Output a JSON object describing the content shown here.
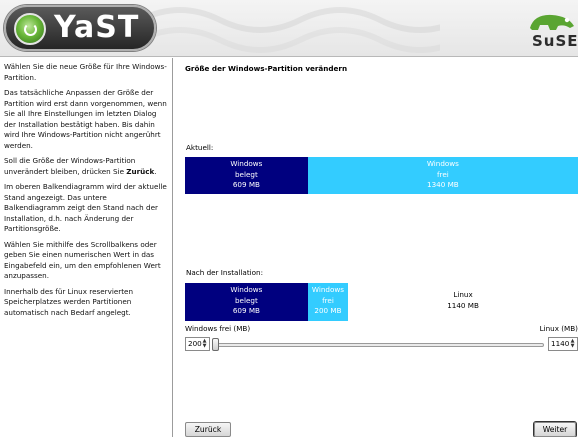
{
  "banner": {
    "app_logo_text": "YaST",
    "vendor_logo_text": "SuSE"
  },
  "help": {
    "paragraphs": [
      "Wählen Sie die neue Größe für Ihre Windows-Partition.",
      "Das tatsächliche Anpassen der Größe der Partition wird erst dann vorgenommen, wenn Sie all Ihre Einstellungen im letzten Dialog der Installation bestätigt haben. Bis dahin wird Ihre Windows-Partition nicht angerührt werden.",
      "Im oberen Balkendiagramm wird der aktuelle Stand angezeigt. Das untere Balkendiagramm zeigt den Stand nach der Installation, d.h. nach Änderung der Partitionsgröße.",
      "Wählen Sie mithilfe des Scrollbalkens oder geben Sie einen numerischen Wert in das Eingabefeld ein, um den empfohlenen Wert anzupassen.",
      "Innerhalb des für Linux reservierten Speicherplatzes werden Partitionen automatisch nach Bedarf angelegt."
    ],
    "unchanged_before": "Soll die Größe der Windows-Partition unverändert bleiben, drücken Sie ",
    "unchanged_bold": "Zurück",
    "unchanged_after": "."
  },
  "dialog": {
    "title": "Größe der Windows-Partition verändern",
    "current_label": "Aktuell:",
    "after_label": "Nach der Installation:"
  },
  "current_bar": {
    "used": {
      "l1": "Windows",
      "l2": "belegt",
      "l3": "609 MB",
      "mb": 609
    },
    "free": {
      "l1": "Windows",
      "l2": "frei",
      "l3": "1340 MB",
      "mb": 1340
    }
  },
  "after_bar": {
    "used": {
      "l1": "Windows",
      "l2": "belegt",
      "l3": "609 MB",
      "mb": 609
    },
    "free": {
      "l1": "Windows",
      "l2": "frei",
      "l3": "200 MB",
      "mb": 200
    },
    "linux": {
      "l1": "Linux",
      "l2": "1140 MB",
      "mb": 1140
    }
  },
  "slider": {
    "left_label": "Windows frei (MB)",
    "right_label": "Linux (MB)",
    "left_value": "200",
    "right_value": "1140",
    "position_fraction": 0.0
  },
  "buttons": {
    "back": "Zurück",
    "next": "Weiter"
  },
  "icons": {
    "yast": "yast-logo-icon",
    "suse": "suse-chameleon-icon",
    "spin_arrows": "spin-arrows-icon"
  },
  "colors": {
    "used": "#00007f",
    "free": "#33ccff",
    "linux": "#ffffff"
  }
}
